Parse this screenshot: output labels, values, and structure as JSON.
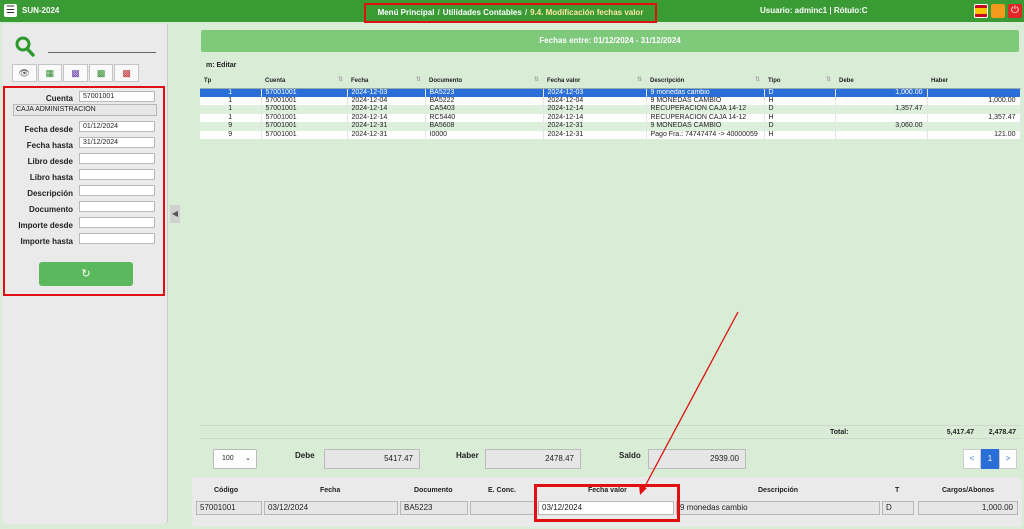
{
  "topbar": {
    "app_name": "SUN-2024",
    "crumb1": "Menú Principal",
    "crumb2": "Utilidades Contables",
    "crumb3": "9.4. Modificación fechas valor",
    "crumb_sep": "/",
    "user": "Usuario: adminc1 | Rótulo:C"
  },
  "sidebar": {
    "filters": {
      "cuenta_label": "Cuenta",
      "cuenta_value": "57001001",
      "caja": "CAJA ADMINISTRACION",
      "fecha_desde_label": "Fecha desde",
      "fecha_desde_value": "01/12/2024",
      "fecha_hasta_label": "Fecha hasta",
      "fecha_hasta_value": "31/12/2024",
      "libro_desde_label": "Libro desde",
      "libro_hasta_label": "Libro hasta",
      "descripcion_label": "Descripción",
      "documento_label": "Documento",
      "importe_desde_label": "Importe desde",
      "importe_hasta_label": "Importe hasta"
    }
  },
  "main": {
    "header": "Fechas entre: 01/12/2024 - 31/12/2024",
    "table_title": "m: Editar",
    "columns": [
      "Tp",
      "Cuenta",
      "Fecha",
      "Documento",
      "Fecha valor",
      "Descripción",
      "Tipo",
      "Debe",
      "Haber"
    ],
    "rows": [
      {
        "tp": "1",
        "cuenta": "57001001",
        "fecha": "2024-12-03",
        "doc": "BA5223",
        "fvalor": "2024-12-03",
        "desc": "9 monedas cambio",
        "tipo": "D",
        "debe": "1,000.00",
        "haber": ""
      },
      {
        "tp": "1",
        "cuenta": "57001001",
        "fecha": "2024-12-04",
        "doc": "BA5222",
        "fvalor": "2024-12-04",
        "desc": "9 MONEDAS CAMBIO",
        "tipo": "H",
        "debe": "",
        "haber": "1,000.00"
      },
      {
        "tp": "1",
        "cuenta": "57001001",
        "fecha": "2024-12-14",
        "doc": "CA5403",
        "fvalor": "2024-12-14",
        "desc": "RECUPERACION CAJA 14-12",
        "tipo": "D",
        "debe": "1,357.47",
        "haber": ""
      },
      {
        "tp": "1",
        "cuenta": "57001001",
        "fecha": "2024-12-14",
        "doc": "RC5440",
        "fvalor": "2024-12-14",
        "desc": "RECUPERACION CAJA 14-12",
        "tipo": "H",
        "debe": "",
        "haber": "1,357.47"
      },
      {
        "tp": "9",
        "cuenta": "57001001",
        "fecha": "2024-12-31",
        "doc": "BA5608",
        "fvalor": "2024-12-31",
        "desc": "9 MONEDAS CAMBIO",
        "tipo": "D",
        "debe": "3,060.00",
        "haber": ""
      },
      {
        "tp": "9",
        "cuenta": "57001001",
        "fecha": "2024-12-31",
        "doc": "I0000",
        "fvalor": "2024-12-31",
        "desc": "Pago Fra.: 74747474 -> 40000059",
        "tipo": "H",
        "debe": "",
        "haber": "121.00"
      }
    ],
    "totals": {
      "label": "Total:",
      "debe": "5,417.47",
      "haber": "2,478.47"
    },
    "page_size": "100",
    "debe_label": "Debe",
    "debe_value": "5417.47",
    "haber_label": "Haber",
    "haber_value": "2478.47",
    "saldo_label": "Saldo",
    "saldo_value": "2939.00",
    "pager": {
      "prev": "<",
      "page": "1",
      "next": ">"
    }
  },
  "editform": {
    "codigo_label": "Código",
    "codigo": "57001001",
    "fecha_label": "Fecha",
    "fecha": "03/12/2024",
    "documento_label": "Documento",
    "documento": "BA5223",
    "econc_label": "E. Conc.",
    "econc": "",
    "fvalor_label": "Fecha valor",
    "fvalor": "03/12/2024",
    "desc_label": "Descripción",
    "desc": "9 monedas cambio",
    "t_label": "T",
    "t": "D",
    "cargos_label": "Cargos/Abonos",
    "cargos": "1,000.00"
  },
  "colors": {
    "topbar": "#3a9b35",
    "band": "#7fc97b",
    "selected": "#2a6fd8",
    "highlight": "#e01010"
  }
}
